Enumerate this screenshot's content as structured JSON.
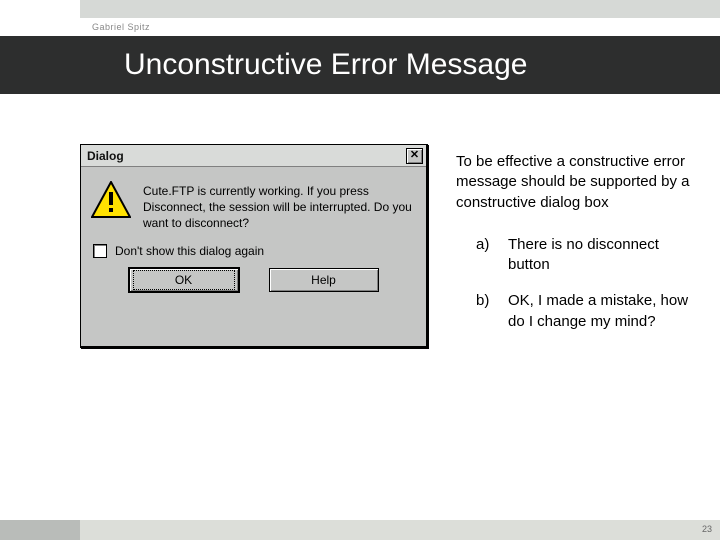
{
  "author": "Gabriel Spitz",
  "title": "Unconstructive Error Message",
  "dialog": {
    "title": "Dialog",
    "close_glyph": "✕",
    "message": "Cute.FTP is currently working. If you press Disconnect, the session will be interrupted. Do you want to disconnect?",
    "checkbox_label": "Don't show this dialog again",
    "ok_label": "OK",
    "help_label": "Help"
  },
  "explain": {
    "main": "To be effective a constructive error message should be supported by a constructive dialog box",
    "items": [
      {
        "label": "a)",
        "text": "There is no disconnect button"
      },
      {
        "label": "b)",
        "text": "OK, I made a mistake, how do I change my mind?"
      }
    ]
  },
  "page_number": "23"
}
